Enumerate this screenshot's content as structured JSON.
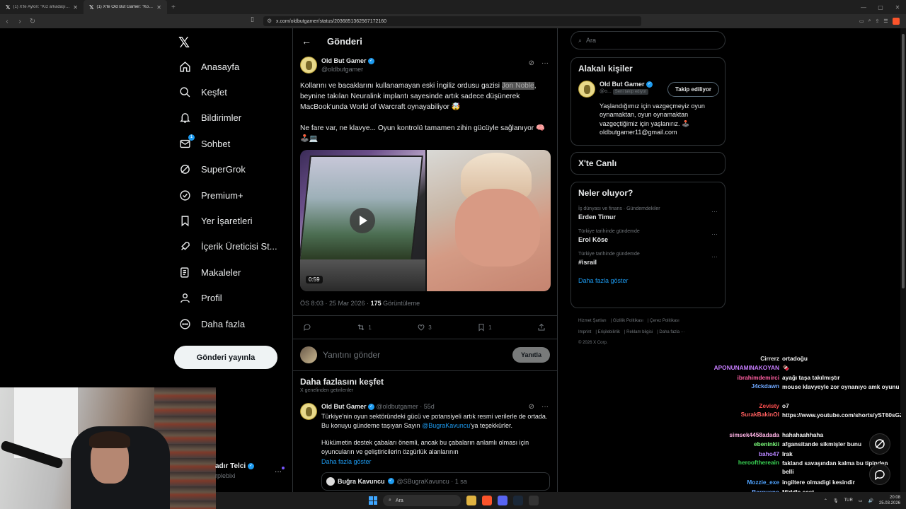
{
  "browser": {
    "tabs": [
      {
        "label": "(1) X'te Aylon: \"Kız arkadaşına büyü y",
        "active": false
      },
      {
        "label": "(1) X'te Old But Gamer: \"Kollarını ve",
        "active": true
      }
    ],
    "url": "x.com/oldbutgamer/status/2036851362567172160"
  },
  "nav": {
    "items": [
      {
        "label": "Anasayfa",
        "icon": "home-icon"
      },
      {
        "label": "Keşfet",
        "icon": "search-icon"
      },
      {
        "label": "Bildirimler",
        "icon": "bell-icon"
      },
      {
        "label": "Sohbet",
        "icon": "mail-icon",
        "badge": "1"
      },
      {
        "label": "SuperGrok",
        "icon": "grok-icon"
      },
      {
        "label": "Premium+",
        "icon": "premium-icon"
      },
      {
        "label": "Yer İşaretleri",
        "icon": "bookmark-icon"
      },
      {
        "label": "İçerik Üreticisi St...",
        "icon": "rocket-icon"
      },
      {
        "label": "Makaleler",
        "icon": "article-icon"
      },
      {
        "label": "Profil",
        "icon": "person-icon"
      },
      {
        "label": "Daha fazla",
        "icon": "more-circle-icon"
      }
    ],
    "post_button": "Gönderi yayınla",
    "account_name": "adır Telci",
    "account_handle": "rplebixi"
  },
  "header": {
    "title": "Gönderi"
  },
  "post": {
    "author": "Old But Gamer",
    "handle": "@oldbutgamer",
    "text_before": "Kollarını ve bacaklarını kullanamayan eski İngiliz ordusu gazisi ",
    "highlight": "Jon Noble",
    "text_after": ", beynine takılan Neuralink implantı sayesinde artık sadece düşünerek MacBook'unda World of Warcraft oynayabiliyor 🤯",
    "text2": "Ne fare var, ne klavye... Oyun kontrolü tamamen zihin gücüyle sağlanıyor 🧠🕹️💻",
    "video_duration": "0:59",
    "timestamp": "ÖS 8:03 · 25 Mar 2026 · ",
    "views_count": "175",
    "views_label": "Görüntüleme",
    "retweets": "1",
    "likes": "3",
    "bookmarks": "1",
    "reply_placeholder": "Yanıtını gönder",
    "reply_button": "Yanıtla"
  },
  "discover": {
    "title": "Daha fazlasını keşfet",
    "subtitle": "X genelinden getirilenler",
    "post": {
      "author": "Old But Gamer",
      "handle": "@oldbutgamer · 55d",
      "text1_a": "Türkiye'nin oyun sektöründeki gücü ve potansiyeli artık resmi verilerle de ortada. Bu konuyu gündeme taşıyan Sayın ",
      "mention": "@BugraKavuncu",
      "text1_b": "'ya teşekkürler.",
      "text2": "Hükümetin destek çabaları önemli, ancak bu çabaların anlamlı olması için oyuncuların ve geliştiricilerin özgürlük alanlarının",
      "show_more": "Daha fazla göster",
      "quote_name": "Buğra Kavuncu",
      "quote_handle": "@SBugraKavuncu · 1 sa"
    }
  },
  "right": {
    "search_placeholder": "Ara",
    "related_title": "Alakalı kişiler",
    "related": {
      "name": "Old But Gamer",
      "handle": "@o...",
      "follows_you": "Seni takip ediyor",
      "button": "Takip ediliyor",
      "bio": "Yaşlandığımız için vazgeçmeyiz oyun oynamaktan, oyun oynamaktan vazgeçtiğimiz için yaşlanırız. 🕹️ oldbutgamer11@gmail.com"
    },
    "live_title": "X'te Canlı",
    "trends_title": "Neler oluyor?",
    "trends": [
      {
        "category": "İş dünyası ve finans · Gündemdekiler",
        "name": "Erden Timur"
      },
      {
        "category": "Türkiye tarihinde gündemde",
        "name": "Erol Köse"
      },
      {
        "category": "Türkiye tarihinde gündemde",
        "name": "#israil"
      }
    ],
    "show_more": "Daha fazla göster",
    "footer": [
      "Hizmet Şartları",
      "Gizlilik Politikası",
      "Çerez Politikası",
      "Imprint",
      "Erişilebilirlik",
      "Reklam bilgisi",
      "Daha fazla ···",
      "© 2026 X Corp."
    ]
  },
  "chat": [
    {
      "user": "Cirrerz",
      "color": "#e0e0e0",
      "msg": "ortadoğu"
    },
    {
      "user": "APONUNAMINAKOYAN",
      "color": "#c77dff",
      "msg": "🍫"
    },
    {
      "user": "ibrahimdemirci",
      "color": "#ff5fa2",
      "msg": "ayağı taşa takılmıştır"
    },
    {
      "user": "J4ckdawn",
      "color": "#6fa8ff",
      "msg": "mouse klavyeyle zor oynanıyo amk oyunu"
    },
    {
      "user": "Zevisty",
      "color": "#ff4f4f",
      "msg": "o7"
    },
    {
      "user": "SurakBakinOl",
      "color": "#ff5f5f",
      "msg": "https://www.youtube.com/shorts/yST60sGZSTs"
    },
    {
      "user": "simsek4458adada",
      "color": "#ffb3e6",
      "msg": "hahahaahhaha"
    },
    {
      "user": "ebeninkii",
      "color": "#7dff7d",
      "msg": "afgansitande sikmişler bunu"
    },
    {
      "user": "baho47",
      "color": "#b784ff",
      "msg": "Irak"
    },
    {
      "user": "heroofthereain",
      "color": "#39d353",
      "msg": "fakland savaşından kalma bu tipinden belli"
    },
    {
      "user": "Mozzie_exe",
      "color": "#4fa3ff",
      "msg": "ingiltere olmadigi kesindir"
    },
    {
      "user": "Berquano",
      "color": "#6fa8ff",
      "msg": "Middle east"
    }
  ],
  "taskbar": {
    "search": "Ara",
    "lang": "TUR",
    "time": "20:08",
    "date": "25.03.2026"
  }
}
